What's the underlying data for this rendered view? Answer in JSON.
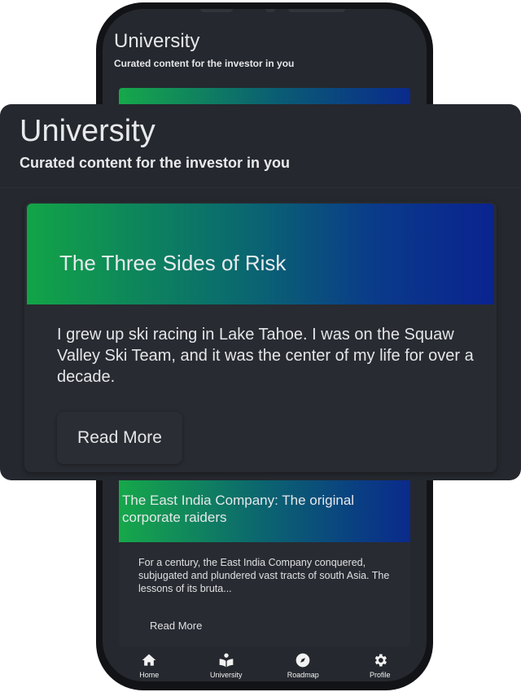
{
  "app": {
    "title": "University",
    "subtitle": "Curated content for the investor in you"
  },
  "articles": [
    {
      "title": "The Three Sides of Risk",
      "excerpt": "I grew up ski racing in Lake Tahoe. I was on the Squaw Valley Ski Team, and it was the center of my life for over a decade.",
      "cta": "Read More"
    },
    {
      "title": "The East India Company: The original corporate raiders",
      "excerpt": "For a century, the East India Company conquered, subjugated and plundered vast tracts of south Asia. The lessons of its bruta...",
      "cta": "Read More"
    }
  ],
  "nav": {
    "items": [
      {
        "label": "Home",
        "icon": "home-icon"
      },
      {
        "label": "University",
        "icon": "reading-person-icon"
      },
      {
        "label": "Roadmap",
        "icon": "compass-icon"
      },
      {
        "label": "Profile",
        "icon": "gear-icon"
      }
    ]
  },
  "colors": {
    "background": "#25282e",
    "card": "#282b31",
    "gradient_start": "#12a447",
    "gradient_end": "#0a2390",
    "text": "#e8e9ec"
  }
}
